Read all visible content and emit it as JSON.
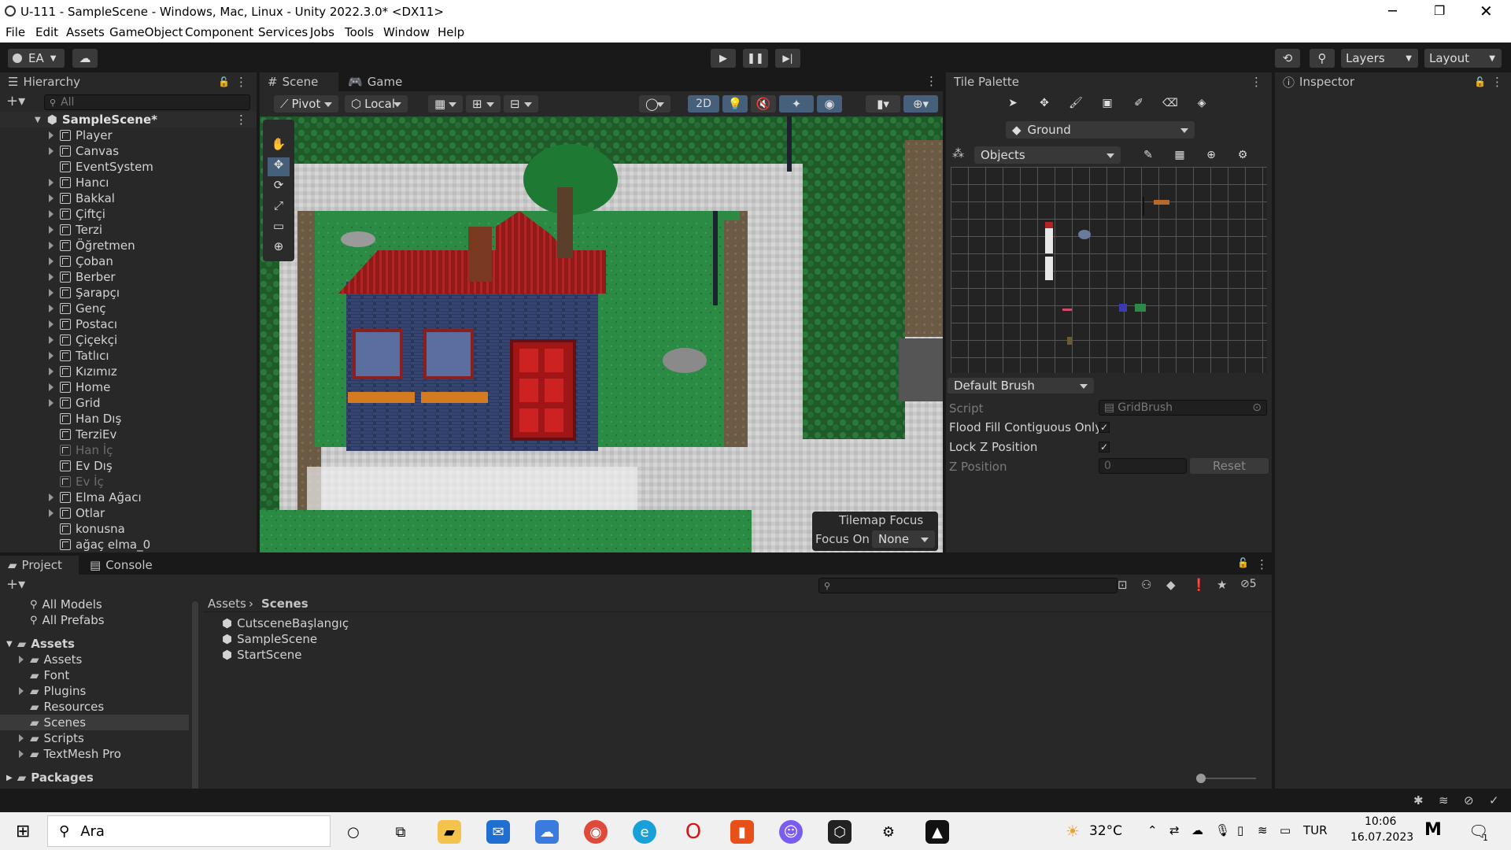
{
  "window": {
    "title": "U-111 - SampleScene - Windows, Mac, Linux - Unity 2022.3.0* <DX11>"
  },
  "menu": [
    "File",
    "Edit",
    "Assets",
    "GameObject",
    "Component",
    "Services",
    "Jobs",
    "Tools",
    "Window",
    "Help"
  ],
  "toolbar": {
    "account": "EA",
    "layers": "Layers",
    "layout": "Layout"
  },
  "hierarchy": {
    "tab": "Hierarchy",
    "search_placeholder": "All",
    "scene": "SampleScene*",
    "items": [
      {
        "label": "Player",
        "arrow": true,
        "disabled": false
      },
      {
        "label": "Canvas",
        "arrow": true,
        "disabled": false
      },
      {
        "label": "EventSystem",
        "arrow": false,
        "disabled": false
      },
      {
        "label": "Hancı",
        "arrow": true,
        "disabled": false
      },
      {
        "label": "Bakkal",
        "arrow": true,
        "disabled": false
      },
      {
        "label": "Çiftçi",
        "arrow": true,
        "disabled": false
      },
      {
        "label": "Terzi",
        "arrow": true,
        "disabled": false
      },
      {
        "label": "Öğretmen",
        "arrow": true,
        "disabled": false
      },
      {
        "label": "Çoban",
        "arrow": true,
        "disabled": false
      },
      {
        "label": "Berber",
        "arrow": true,
        "disabled": false
      },
      {
        "label": "Şarapçı",
        "arrow": true,
        "disabled": false
      },
      {
        "label": "Genç",
        "arrow": true,
        "disabled": false
      },
      {
        "label": "Postacı",
        "arrow": true,
        "disabled": false
      },
      {
        "label": "Çiçekçi",
        "arrow": true,
        "disabled": false
      },
      {
        "label": "Tatlıcı",
        "arrow": true,
        "disabled": false
      },
      {
        "label": "Kızımız",
        "arrow": true,
        "disabled": false
      },
      {
        "label": "Home",
        "arrow": true,
        "disabled": false
      },
      {
        "label": "Grid",
        "arrow": true,
        "disabled": false
      },
      {
        "label": "Han Dış",
        "arrow": false,
        "disabled": false
      },
      {
        "label": "TerziEv",
        "arrow": false,
        "disabled": false
      },
      {
        "label": "Han İç",
        "arrow": false,
        "disabled": true
      },
      {
        "label": "Ev Dış",
        "arrow": false,
        "disabled": false
      },
      {
        "label": "Ev İç",
        "arrow": false,
        "disabled": true
      },
      {
        "label": "Elma Ağacı",
        "arrow": true,
        "disabled": false
      },
      {
        "label": "Otlar",
        "arrow": true,
        "disabled": false
      },
      {
        "label": "konusna",
        "arrow": false,
        "disabled": false
      },
      {
        "label": "ağaç elma_0",
        "arrow": false,
        "disabled": false
      }
    ]
  },
  "scene_view": {
    "tabs": [
      "Scene",
      "Game"
    ],
    "pivot": "Pivot",
    "local": "Local",
    "mode_2d": "2D",
    "overlay_title": "Tilemap Focus",
    "focus_label": "Focus On",
    "focus_value": "None"
  },
  "tile_palette": {
    "tab": "Tile Palette",
    "active_tilemap": "Ground",
    "palette": "Objects",
    "brush": "Default Brush",
    "script_label": "Script",
    "script_value": "GridBrush",
    "flood_label": "Flood Fill Contiguous Only",
    "flood_checked": true,
    "lockz_label": "Lock Z Position",
    "lockz_checked": true,
    "zpos_label": "Z Position",
    "zpos_value": "0",
    "reset_label": "Reset"
  },
  "inspector": {
    "tab": "Inspector"
  },
  "project": {
    "tabs": [
      "Project",
      "Console"
    ],
    "favorites": [
      "All Models",
      "All Prefabs"
    ],
    "root": "Assets",
    "folders": [
      {
        "label": "Assets",
        "arrow": true
      },
      {
        "label": "Font",
        "arrow": false
      },
      {
        "label": "Plugins",
        "arrow": true
      },
      {
        "label": "Resources",
        "arrow": false
      },
      {
        "label": "Scenes",
        "arrow": false,
        "selected": true
      },
      {
        "label": "Scripts",
        "arrow": true
      },
      {
        "label": "TextMesh Pro",
        "arrow": true
      }
    ],
    "packages": "Packages",
    "breadcrumb": [
      "Assets",
      "Scenes"
    ],
    "files": [
      "CutsceneBaşlangıç",
      "SampleScene",
      "StartScene"
    ],
    "hidden_count": "5"
  },
  "taskbar": {
    "search": "Ara",
    "temperature": "32°C",
    "lang": "TUR",
    "time": "10:06",
    "date": "16.07.2023",
    "notif": "1"
  }
}
